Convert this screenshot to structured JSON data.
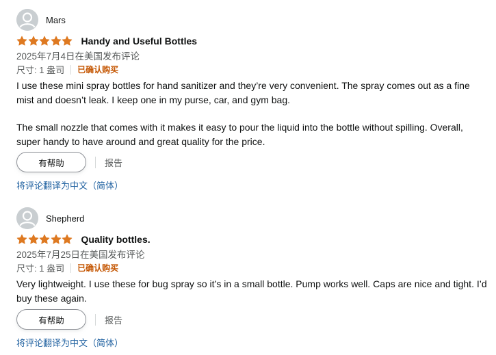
{
  "colors": {
    "star": "#de7921",
    "verified": "#c45500",
    "link": "#2162a1",
    "muted_text": "#565959",
    "text": "#0f1111"
  },
  "reviews": [
    {
      "reviewer": "Mars",
      "avatar_icon": "default-user-avatar-icon",
      "rating": 5,
      "rating_max": 5,
      "title": "Handy and Useful Bottles",
      "date": "2025年7月4日在美国发布评论",
      "size_label": "尺寸: 1 盎司",
      "verified_label": "已确认购买",
      "body": [
        "I use these mini spray bottles for hand sanitizer and they’re very convenient. The spray comes out as a fine mist and doesn’t leak. I keep one in my purse, car, and gym bag.",
        "The small nozzle that comes with it makes it easy to pour the liquid into the bottle without spilling. Overall, super handy to have around and great quality for the price."
      ],
      "helpful_label": "有帮助",
      "report_label": "报告",
      "translate_label": "将评论翻译为中文（简体）"
    },
    {
      "reviewer": "Shepherd",
      "avatar_icon": "default-user-avatar-icon",
      "rating": 5,
      "rating_max": 5,
      "title": "Quality bottles.",
      "date": "2025年7月25日在美国发布评论",
      "size_label": "尺寸: 1 盎司",
      "verified_label": "已确认购买",
      "body": [
        "Very lightweight. I use these for bug spray so it’s in a small bottle. Pump works well. Caps are nice and tight. I’d buy these again."
      ],
      "helpful_label": "有帮助",
      "report_label": "报告",
      "translate_label": "将评论翻译为中文（简体）"
    }
  ]
}
